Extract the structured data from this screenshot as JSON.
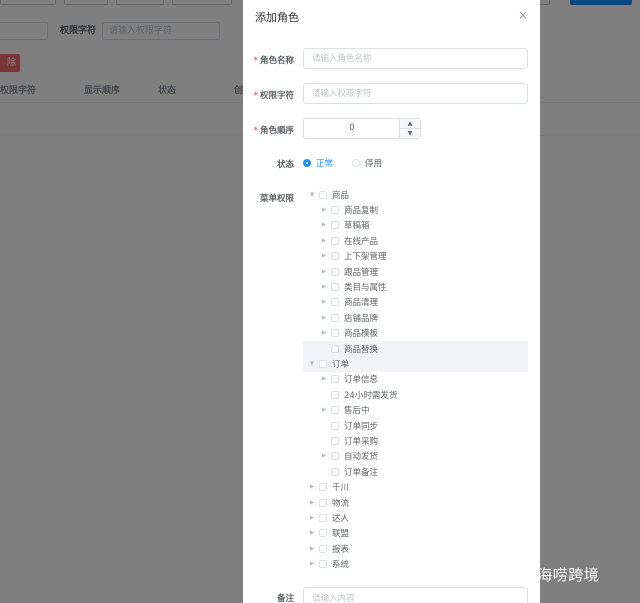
{
  "background": {
    "filter": {
      "perm_label": "权限字符",
      "perm_placeholder": "请输入权限字符"
    },
    "delete_label": "除",
    "table_headers": [
      "权限字符",
      "显示顺序",
      "状态",
      "创"
    ]
  },
  "dialog": {
    "title": "添加角色",
    "close_icon": "×",
    "fields": {
      "role_name": {
        "label": "角色名称",
        "placeholder": "请输入角色名称"
      },
      "perm_key": {
        "label": "权限字符",
        "placeholder": "请输入权限字符"
      },
      "role_sort": {
        "label": "角色顺序",
        "value": "0"
      },
      "status": {
        "label": "状态",
        "options": [
          "正常",
          "停用"
        ],
        "selected": "正常"
      },
      "menu_perms": {
        "label": "菜单权限"
      },
      "remark": {
        "label": "备注",
        "placeholder": "请输入内容"
      }
    },
    "menu_tree": [
      {
        "label": "商品",
        "level": 0,
        "arrow": "expanded"
      },
      {
        "label": "商品复制",
        "level": 1,
        "arrow": "collapsed"
      },
      {
        "label": "草稿箱",
        "level": 1,
        "arrow": "collapsed"
      },
      {
        "label": "在线产品",
        "level": 1,
        "arrow": "collapsed"
      },
      {
        "label": "上下架管理",
        "level": 1,
        "arrow": "collapsed"
      },
      {
        "label": "跟品管理",
        "level": 1,
        "arrow": "collapsed"
      },
      {
        "label": "类目与属性",
        "level": 1,
        "arrow": "collapsed"
      },
      {
        "label": "商品清理",
        "level": 1,
        "arrow": "collapsed"
      },
      {
        "label": "店铺品牌",
        "level": 1,
        "arrow": "collapsed"
      },
      {
        "label": "商品模板",
        "level": 1,
        "arrow": "collapsed"
      },
      {
        "label": "商品替换",
        "level": 1,
        "arrow": "none",
        "highlight": true
      },
      {
        "label": "订单",
        "level": 0,
        "arrow": "expanded",
        "highlight": true
      },
      {
        "label": "订单信息",
        "level": 1,
        "arrow": "collapsed"
      },
      {
        "label": "24小时需发货",
        "level": 1,
        "arrow": "none"
      },
      {
        "label": "售后中",
        "level": 1,
        "arrow": "collapsed"
      },
      {
        "label": "订单同步",
        "level": 1,
        "arrow": "none"
      },
      {
        "label": "订单采购",
        "level": 1,
        "arrow": "none"
      },
      {
        "label": "自动发货",
        "level": 1,
        "arrow": "collapsed"
      },
      {
        "label": "订单备注",
        "level": 1,
        "arrow": "none"
      },
      {
        "label": "千川",
        "level": 0,
        "arrow": "collapsed"
      },
      {
        "label": "物流",
        "level": 0,
        "arrow": "collapsed"
      },
      {
        "label": "达人",
        "level": 0,
        "arrow": "collapsed"
      },
      {
        "label": "联盟",
        "level": 0,
        "arrow": "collapsed"
      },
      {
        "label": "报表",
        "level": 0,
        "arrow": "collapsed"
      },
      {
        "label": "系统",
        "level": 0,
        "arrow": "collapsed"
      }
    ],
    "icons": {
      "expanded": "▼",
      "collapsed": "▶",
      "spin_up": "▲",
      "spin_down": "▼"
    }
  },
  "watermark": "知乎 @小海唠跨境",
  "colors": {
    "primary": "#1890ff",
    "danger": "#f56c6c",
    "required": "#f56c6c",
    "overlay": "rgba(0,0,0,0.5)"
  }
}
